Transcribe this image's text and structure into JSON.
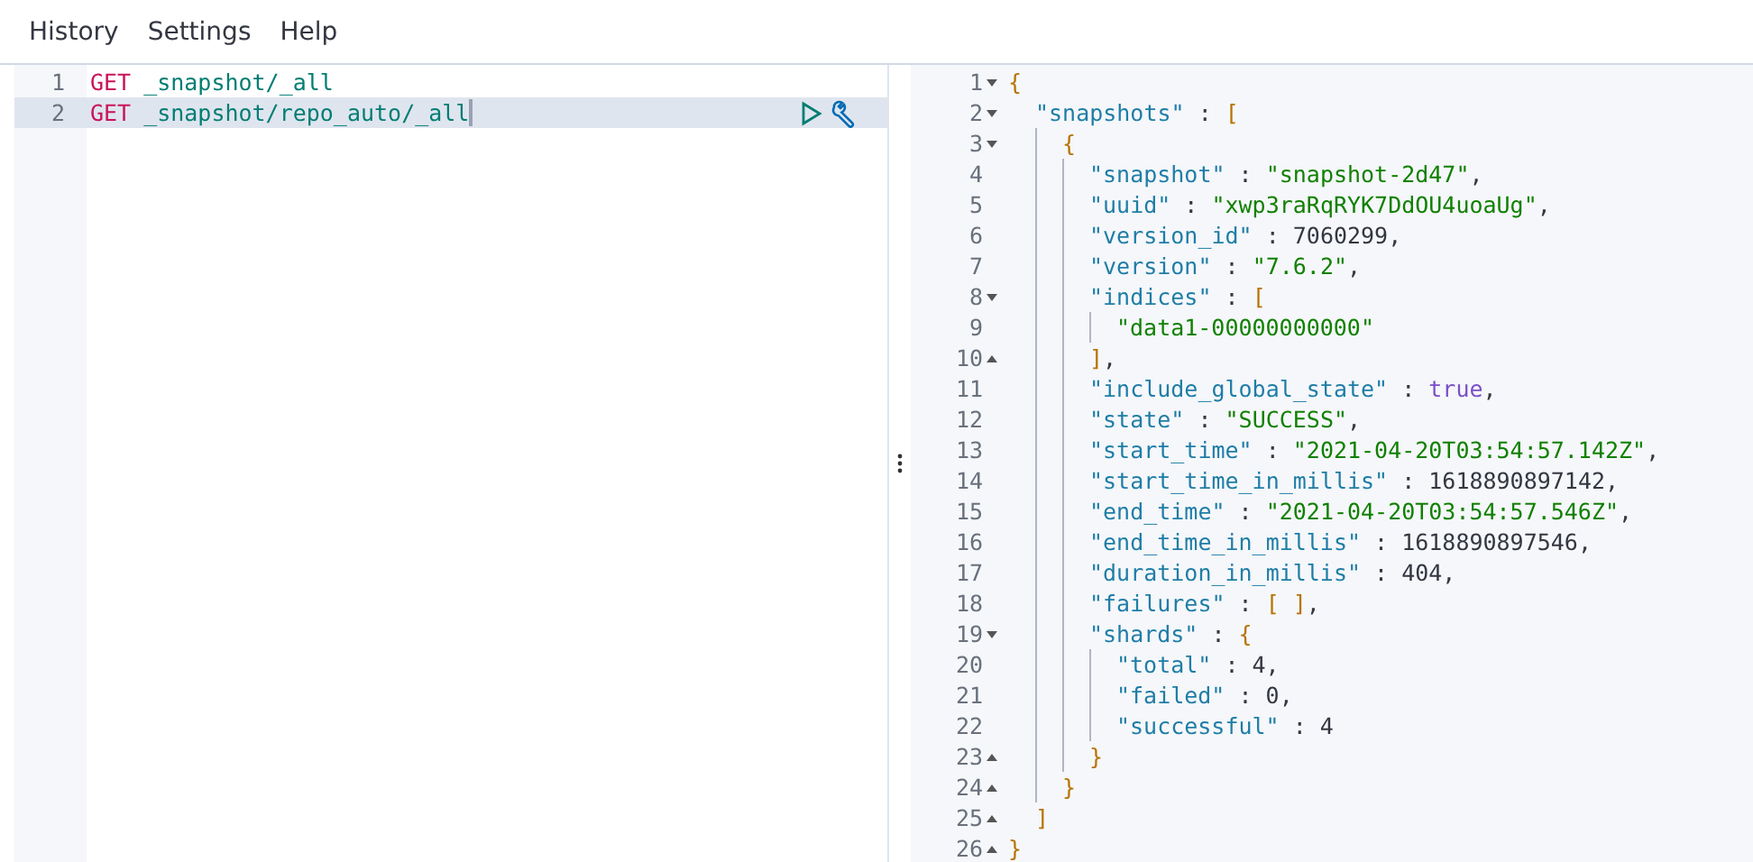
{
  "menu": [
    {
      "label": "History"
    },
    {
      "label": "Settings"
    },
    {
      "label": "Help"
    }
  ],
  "request_editor": {
    "lines": [
      {
        "number": "1",
        "selected": false,
        "method": "GET",
        "path": "_snapshot/_all"
      },
      {
        "number": "2",
        "selected": true,
        "method": "GET",
        "path": "_snapshot/repo_auto/_all"
      }
    ]
  },
  "response_viewer": {
    "root": {
      "number": "1",
      "tokens": [
        {
          "kind": "bracket",
          "text": "{"
        }
      ],
      "children": [
        {
          "number": "2",
          "tokens": [
            {
              "kind": "key",
              "text": "\"snapshots\""
            },
            {
              "kind": "punct",
              "text": " : "
            },
            {
              "kind": "bracket",
              "text": "["
            }
          ],
          "children": [
            {
              "number": "3",
              "tokens": [
                {
                  "kind": "bracket",
                  "text": "{"
                }
              ],
              "children": [
                {
                  "number": "4",
                  "tokens": [
                    {
                      "kind": "key",
                      "text": "\"snapshot\""
                    },
                    {
                      "kind": "punct",
                      "text": " : "
                    },
                    {
                      "kind": "string",
                      "text": "\"snapshot-2d47\""
                    },
                    {
                      "kind": "punct",
                      "text": ","
                    }
                  ]
                },
                {
                  "number": "5",
                  "tokens": [
                    {
                      "kind": "key",
                      "text": "\"uuid\""
                    },
                    {
                      "kind": "punct",
                      "text": " : "
                    },
                    {
                      "kind": "string",
                      "text": "\"xwp3raRqRYK7DdOU4uoaUg\""
                    },
                    {
                      "kind": "punct",
                      "text": ","
                    }
                  ]
                },
                {
                  "number": "6",
                  "tokens": [
                    {
                      "kind": "key",
                      "text": "\"version_id\""
                    },
                    {
                      "kind": "punct",
                      "text": " : "
                    },
                    {
                      "kind": "number",
                      "text": "7060299"
                    },
                    {
                      "kind": "punct",
                      "text": ","
                    }
                  ]
                },
                {
                  "number": "7",
                  "tokens": [
                    {
                      "kind": "key",
                      "text": "\"version\""
                    },
                    {
                      "kind": "punct",
                      "text": " : "
                    },
                    {
                      "kind": "string",
                      "text": "\"7.6.2\""
                    },
                    {
                      "kind": "punct",
                      "text": ","
                    }
                  ]
                },
                {
                  "number": "8",
                  "tokens": [
                    {
                      "kind": "key",
                      "text": "\"indices\""
                    },
                    {
                      "kind": "punct",
                      "text": " : "
                    },
                    {
                      "kind": "bracket",
                      "text": "["
                    }
                  ],
                  "children": [
                    {
                      "number": "9",
                      "tokens": [
                        {
                          "kind": "string",
                          "text": "\"data1-00000000000\""
                        }
                      ]
                    }
                  ],
                  "end": {
                    "number": "10",
                    "tokens": [
                      {
                        "kind": "bracket",
                        "text": "]"
                      },
                      {
                        "kind": "punct",
                        "text": ","
                      }
                    ]
                  }
                },
                {
                  "number": "11",
                  "tokens": [
                    {
                      "kind": "key",
                      "text": "\"include_global_state\""
                    },
                    {
                      "kind": "punct",
                      "text": " : "
                    },
                    {
                      "kind": "bool",
                      "text": "true"
                    },
                    {
                      "kind": "punct",
                      "text": ","
                    }
                  ]
                },
                {
                  "number": "12",
                  "tokens": [
                    {
                      "kind": "key",
                      "text": "\"state\""
                    },
                    {
                      "kind": "punct",
                      "text": " : "
                    },
                    {
                      "kind": "string",
                      "text": "\"SUCCESS\""
                    },
                    {
                      "kind": "punct",
                      "text": ","
                    }
                  ]
                },
                {
                  "number": "13",
                  "tokens": [
                    {
                      "kind": "key",
                      "text": "\"start_time\""
                    },
                    {
                      "kind": "punct",
                      "text": " : "
                    },
                    {
                      "kind": "string",
                      "text": "\"2021-04-20T03:54:57.142Z\""
                    },
                    {
                      "kind": "punct",
                      "text": ","
                    }
                  ]
                },
                {
                  "number": "14",
                  "tokens": [
                    {
                      "kind": "key",
                      "text": "\"start_time_in_millis\""
                    },
                    {
                      "kind": "punct",
                      "text": " : "
                    },
                    {
                      "kind": "number",
                      "text": "1618890897142"
                    },
                    {
                      "kind": "punct",
                      "text": ","
                    }
                  ]
                },
                {
                  "number": "15",
                  "tokens": [
                    {
                      "kind": "key",
                      "text": "\"end_time\""
                    },
                    {
                      "kind": "punct",
                      "text": " : "
                    },
                    {
                      "kind": "string",
                      "text": "\"2021-04-20T03:54:57.546Z\""
                    },
                    {
                      "kind": "punct",
                      "text": ","
                    }
                  ]
                },
                {
                  "number": "16",
                  "tokens": [
                    {
                      "kind": "key",
                      "text": "\"end_time_in_millis\""
                    },
                    {
                      "kind": "punct",
                      "text": " : "
                    },
                    {
                      "kind": "number",
                      "text": "1618890897546"
                    },
                    {
                      "kind": "punct",
                      "text": ","
                    }
                  ]
                },
                {
                  "number": "17",
                  "tokens": [
                    {
                      "kind": "key",
                      "text": "\"duration_in_millis\""
                    },
                    {
                      "kind": "punct",
                      "text": " : "
                    },
                    {
                      "kind": "number",
                      "text": "404"
                    },
                    {
                      "kind": "punct",
                      "text": ","
                    }
                  ]
                },
                {
                  "number": "18",
                  "tokens": [
                    {
                      "kind": "key",
                      "text": "\"failures\""
                    },
                    {
                      "kind": "punct",
                      "text": " : "
                    },
                    {
                      "kind": "bracket",
                      "text": "[ ]"
                    },
                    {
                      "kind": "punct",
                      "text": ","
                    }
                  ]
                },
                {
                  "number": "19",
                  "tokens": [
                    {
                      "kind": "key",
                      "text": "\"shards\""
                    },
                    {
                      "kind": "punct",
                      "text": " : "
                    },
                    {
                      "kind": "bracket",
                      "text": "{"
                    }
                  ],
                  "children": [
                    {
                      "number": "20",
                      "tokens": [
                        {
                          "kind": "key",
                          "text": "\"total\""
                        },
                        {
                          "kind": "punct",
                          "text": " : "
                        },
                        {
                          "kind": "number",
                          "text": "4"
                        },
                        {
                          "kind": "punct",
                          "text": ","
                        }
                      ]
                    },
                    {
                      "number": "21",
                      "tokens": [
                        {
                          "kind": "key",
                          "text": "\"failed\""
                        },
                        {
                          "kind": "punct",
                          "text": " : "
                        },
                        {
                          "kind": "number",
                          "text": "0"
                        },
                        {
                          "kind": "punct",
                          "text": ","
                        }
                      ]
                    },
                    {
                      "number": "22",
                      "tokens": [
                        {
                          "kind": "key",
                          "text": "\"successful\""
                        },
                        {
                          "kind": "punct",
                          "text": " : "
                        },
                        {
                          "kind": "number",
                          "text": "4"
                        }
                      ]
                    }
                  ],
                  "end": {
                    "number": "23",
                    "tokens": [
                      {
                        "kind": "bracket",
                        "text": "}"
                      }
                    ]
                  }
                }
              ],
              "end": {
                "number": "24",
                "tokens": [
                  {
                    "kind": "bracket",
                    "text": "}"
                  }
                ]
              }
            }
          ],
          "end": {
            "number": "25",
            "tokens": [
              {
                "kind": "bracket",
                "text": "]"
              }
            ]
          }
        }
      ],
      "end": {
        "number": "26",
        "tokens": [
          {
            "kind": "bracket",
            "text": "}"
          }
        ]
      }
    }
  }
}
